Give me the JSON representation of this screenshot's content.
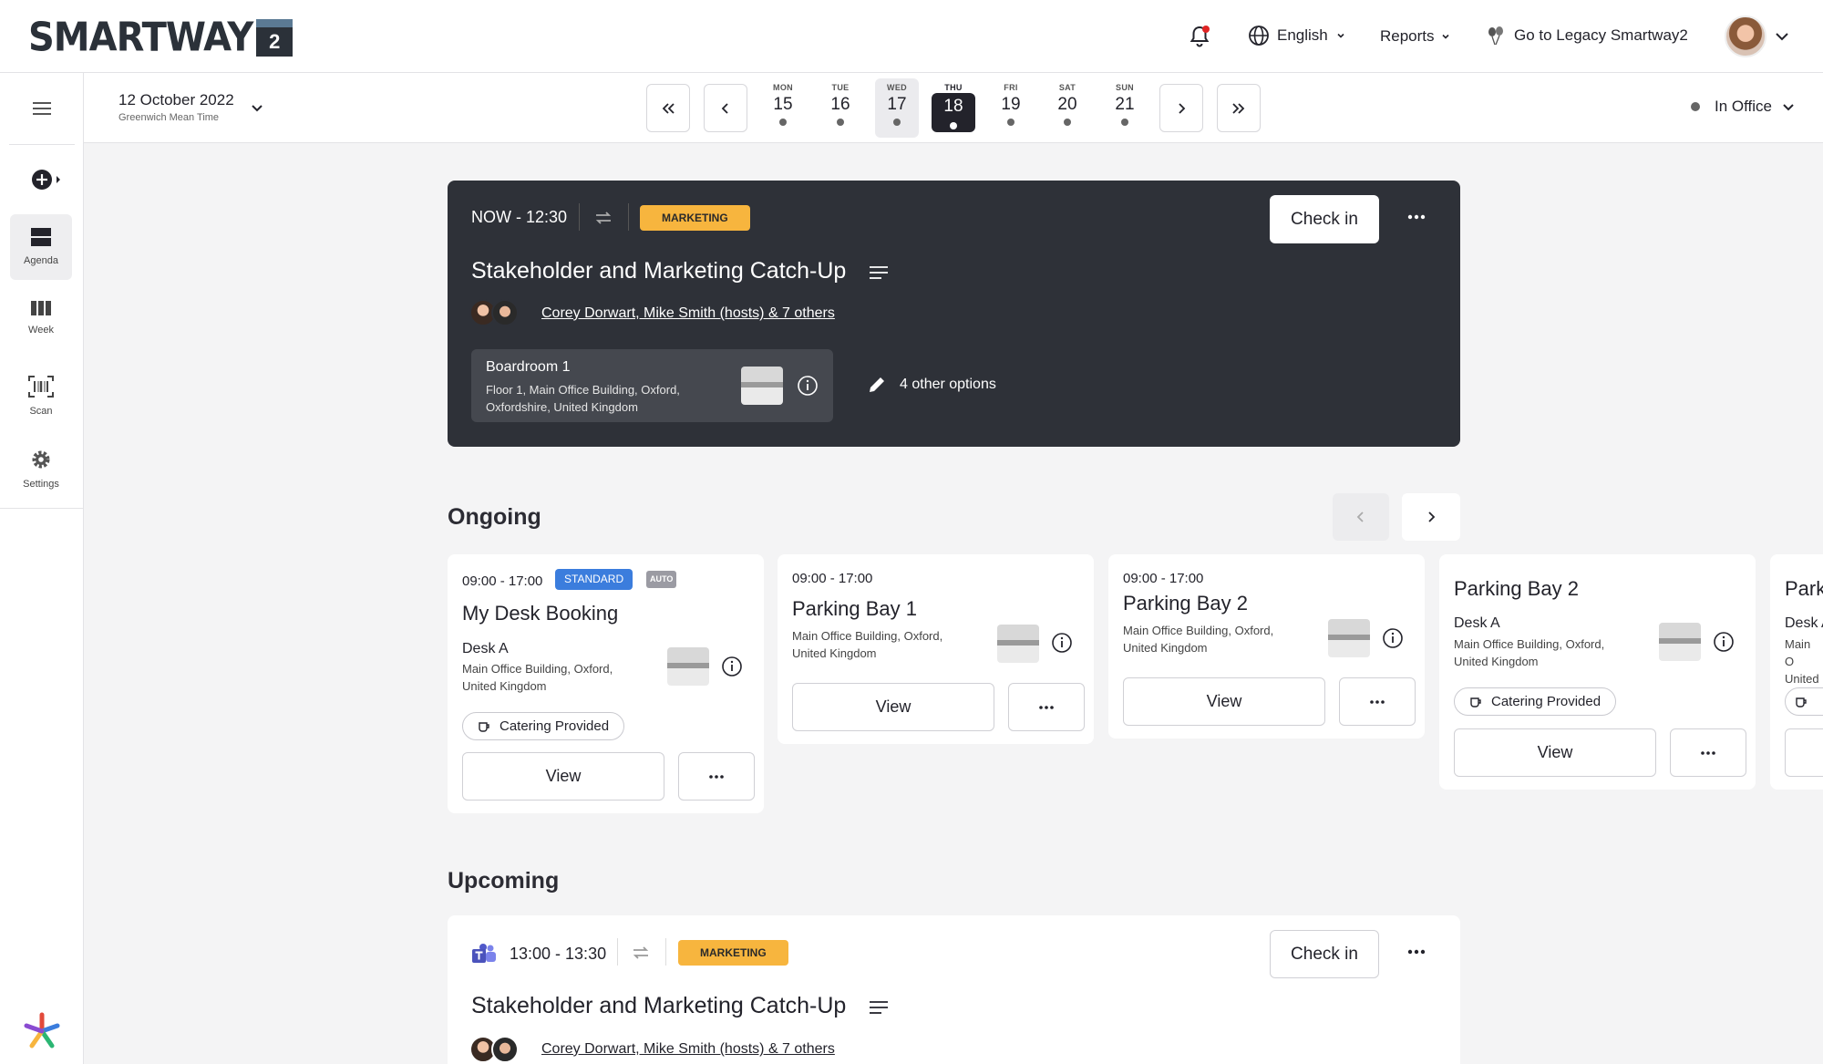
{
  "app": {
    "logo_text": "SMARTWAY",
    "logo_num": "2"
  },
  "header": {
    "language": "English",
    "reports": "Reports",
    "legacy": "Go to Legacy Smartway2"
  },
  "sidebar": {
    "items": [
      {
        "label": "Agenda",
        "icon": "agenda-icon"
      },
      {
        "label": "Week",
        "icon": "week-icon"
      },
      {
        "label": "Scan",
        "icon": "barcode-icon"
      },
      {
        "label": "Settings",
        "icon": "gear-icon"
      }
    ]
  },
  "datebar": {
    "date": "12 October 2022",
    "timezone": "Greenwich Mean Time",
    "days": [
      {
        "name": "MON",
        "num": "15"
      },
      {
        "name": "TUE",
        "num": "16"
      },
      {
        "name": "WED",
        "num": "17"
      },
      {
        "name": "THU",
        "num": "18"
      },
      {
        "name": "FRI",
        "num": "19"
      },
      {
        "name": "SAT",
        "num": "20"
      },
      {
        "name": "SUN",
        "num": "21"
      }
    ],
    "status": "In Office"
  },
  "hero": {
    "time": "NOW - 12:30",
    "tag": "MARKETING",
    "checkin": "Check in",
    "title": "Stakeholder and Marketing Catch-Up",
    "hosts": "Corey Dorwart, Mike Smith (hosts) & 7 others",
    "room_name": "Boardroom 1",
    "room_addr": "Floor 1, Main Office Building, Oxford, Oxfordshire, United Kingdom",
    "options": "4 other options"
  },
  "ongoing": {
    "heading": "Ongoing",
    "cards": [
      {
        "time": "09:00 - 17:00",
        "tag": "STANDARD",
        "auto": "AUTO",
        "title": "My Desk Booking",
        "desk": "Desk A",
        "addr": "Main Office Building, Oxford, United Kingdom",
        "pill": "Catering Provided",
        "view": "View"
      },
      {
        "time": "09:00 - 17:00",
        "title": "Parking Bay 1",
        "addr": "Main Office Building, Oxford, United Kingdom",
        "view": "View"
      },
      {
        "time": "09:00 - 17:00",
        "title": "Parking Bay 2",
        "addr": "Main Office Building, Oxford, United Kingdom",
        "view": "View"
      },
      {
        "title": "Parking Bay 2",
        "desk": "Desk A",
        "addr": "Main Office Building, Oxford, United Kingdom",
        "pill": "Catering Provided",
        "view": "View"
      },
      {
        "title": "Park",
        "desk": "Desk A",
        "addr": "Main O United"
      }
    ]
  },
  "upcoming": {
    "heading": "Upcoming",
    "time": "13:00 - 13:30",
    "tag": "MARKETING",
    "checkin": "Check in",
    "title": "Stakeholder and Marketing Catch-Up",
    "hosts": "Corey Dorwart, Mike Smith (hosts) & 7 others"
  },
  "colors": {
    "accent": "#f7b53e",
    "dark": "#2e3138",
    "standard": "#3b7ddd"
  }
}
